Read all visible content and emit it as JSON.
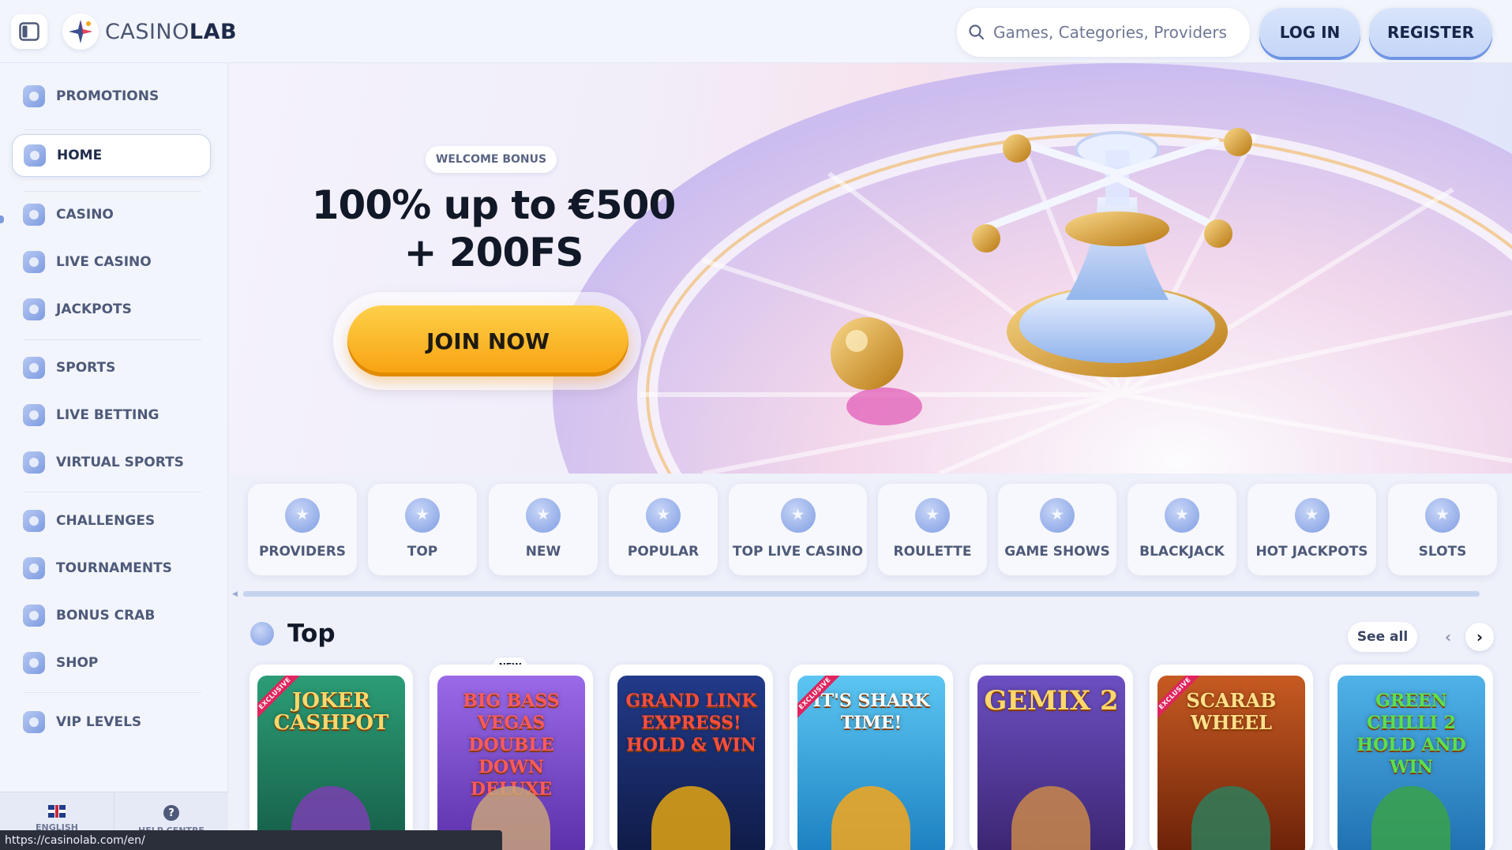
{
  "header": {
    "logo_prefix": "CASINO",
    "logo_suffix": "LAB",
    "search_placeholder": "Games, Categories, Providers",
    "login_label": "LOG IN",
    "register_label": "REGISTER"
  },
  "sidebar": {
    "items": [
      {
        "label": "PROMOTIONS"
      },
      {
        "label": "HOME"
      },
      {
        "label": "CASINO"
      },
      {
        "label": "LIVE CASINO"
      },
      {
        "label": "JACKPOTS"
      },
      {
        "label": "SPORTS"
      },
      {
        "label": "LIVE BETTING"
      },
      {
        "label": "VIRTUAL SPORTS"
      },
      {
        "label": "CHALLENGES"
      },
      {
        "label": "TOURNAMENTS"
      },
      {
        "label": "BONUS CRAB"
      },
      {
        "label": "SHOP"
      },
      {
        "label": "VIP LEVELS"
      }
    ],
    "footer": {
      "language": "ENGLISH",
      "help": "HELP CENTRE"
    }
  },
  "hero": {
    "badge": "WELCOME BONUS",
    "title_line1": "100% up to €500",
    "title_line2": "+ 200FS",
    "cta": "JOIN NOW"
  },
  "categories": [
    {
      "label": "PROVIDERS"
    },
    {
      "label": "TOP"
    },
    {
      "label": "NEW"
    },
    {
      "label": "POPULAR"
    },
    {
      "label": "TOP LIVE CASINO"
    },
    {
      "label": "ROULETTE"
    },
    {
      "label": "GAME SHOWS"
    },
    {
      "label": "BLACKJACK"
    },
    {
      "label": "HOT JACKPOTS"
    },
    {
      "label": "SLOTS"
    }
  ],
  "top_section": {
    "title": "Top",
    "see_all": "See all",
    "new_badge": "NEW",
    "exclusive_label": "EXCLUSIVE",
    "games": [
      {
        "title": "JOKER CASHPOT",
        "exclusive": true,
        "bg": "#1f8a6a"
      },
      {
        "title": "BIG BASS VEGAS DOUBLE DOWN DELUXE",
        "exclusive": false,
        "bg": "#7a4bd4"
      },
      {
        "title": "GRAND LINK EXPRESS! HOLD & WIN",
        "exclusive": false,
        "bg": "#1b2d6e"
      },
      {
        "title": "IT'S SHARK TIME!",
        "exclusive": true,
        "bg": "#2aa7e0"
      },
      {
        "title": "GEMIX 2",
        "exclusive": false,
        "bg": "#5a3fa8"
      },
      {
        "title": "SCARAB WHEEL",
        "exclusive": true,
        "bg": "#b0451a"
      },
      {
        "title": "GREEN CHILLI 2 HOLD AND WIN",
        "exclusive": false,
        "bg": "#1f8fd0"
      }
    ]
  },
  "status_url": "https://casinolab.com/en/",
  "colors": {
    "accent": "#7e9be0",
    "cta": "#f7a10f",
    "text_dark": "#111827"
  }
}
